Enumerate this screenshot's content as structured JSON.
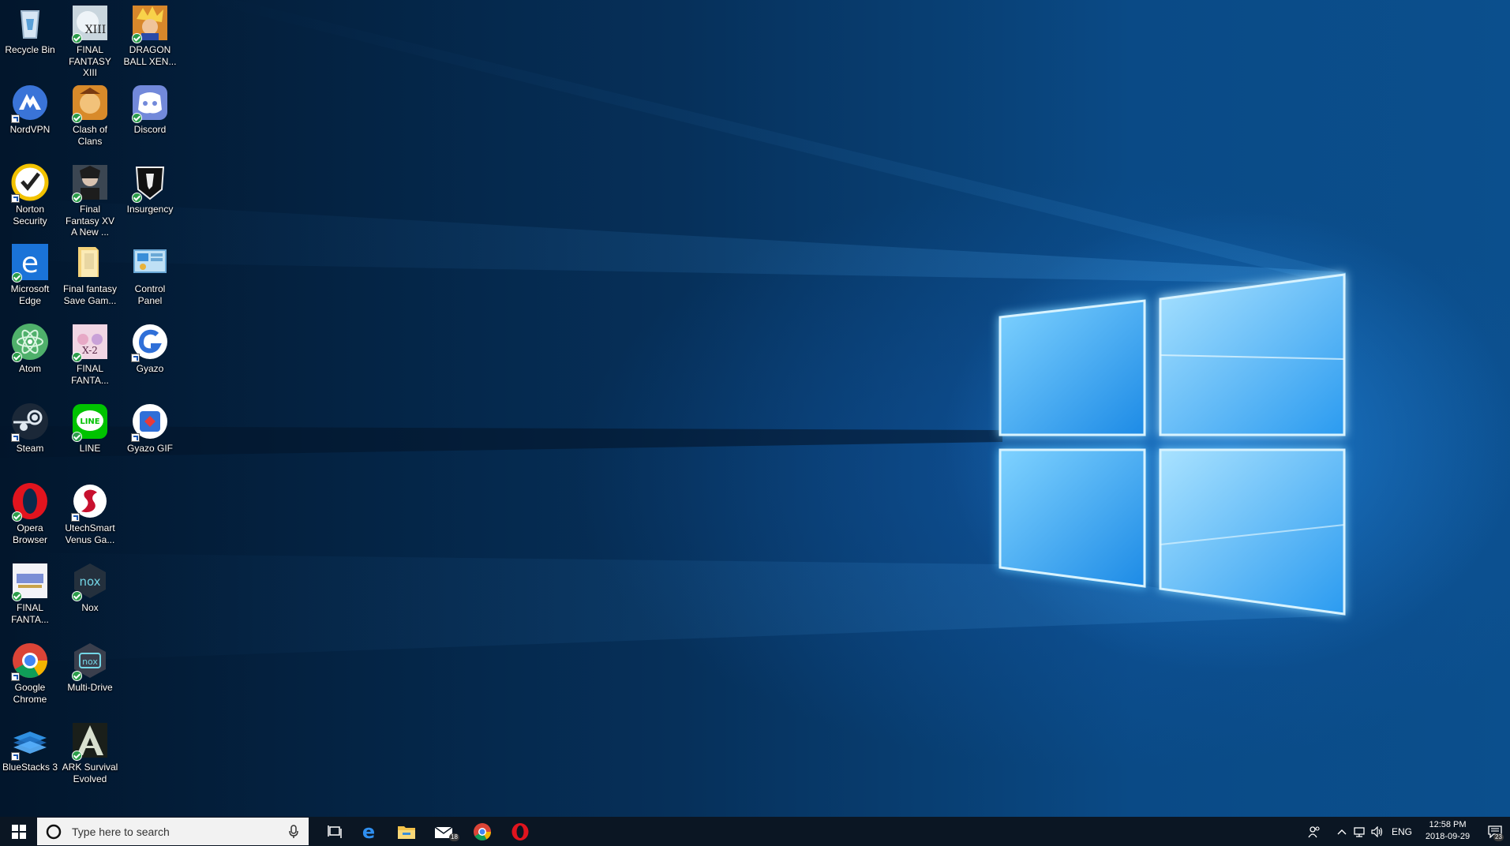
{
  "desktop": {
    "icons": [
      {
        "label": "Recycle Bin",
        "icon": "recycle-bin-icon"
      },
      {
        "label": "FINAL FANTASY XIII",
        "icon": "final-fantasy-xiii-icon"
      },
      {
        "label": "DRAGON BALL XEN...",
        "icon": "dragon-ball-icon"
      },
      {
        "label": "NordVPN",
        "icon": "nordvpn-icon"
      },
      {
        "label": "Clash of Clans",
        "icon": "clash-of-clans-icon"
      },
      {
        "label": "Discord",
        "icon": "discord-icon"
      },
      {
        "label": "Norton Security",
        "icon": "norton-icon"
      },
      {
        "label": "Final Fantasy XV  A New ...",
        "icon": "final-fantasy-xv-icon"
      },
      {
        "label": "Insurgency",
        "icon": "insurgency-icon"
      },
      {
        "label": "Microsoft Edge",
        "icon": "edge-icon"
      },
      {
        "label": "Final fantasy Save Gam...",
        "icon": "folder-icon"
      },
      {
        "label": "Control Panel",
        "icon": "control-panel-icon"
      },
      {
        "label": "Atom",
        "icon": "atom-icon"
      },
      {
        "label": "FINAL FANTA...",
        "icon": "final-fantasy-x2-icon"
      },
      {
        "label": "Gyazo",
        "icon": "gyazo-icon"
      },
      {
        "label": "Steam",
        "icon": "steam-icon"
      },
      {
        "label": "LINE",
        "icon": "line-icon"
      },
      {
        "label": "Gyazo GIF",
        "icon": "gyazo-gif-icon"
      },
      {
        "label": "Opera Browser",
        "icon": "opera-icon"
      },
      {
        "label": "UtechSmart Venus Ga...",
        "icon": "utechsmart-icon"
      },
      {
        "label": "FINAL FANTA...",
        "icon": "final-fantasy-icon"
      },
      {
        "label": "Nox",
        "icon": "nox-icon"
      },
      {
        "label": "Google Chrome",
        "icon": "chrome-icon"
      },
      {
        "label": "Multi-Drive",
        "icon": "multi-drive-icon"
      },
      {
        "label": "BlueStacks 3",
        "icon": "bluestacks-icon"
      },
      {
        "label": "ARK Survival Evolved",
        "icon": "ark-icon"
      }
    ]
  },
  "taskbar": {
    "search_placeholder": "Type here to search",
    "mail_badge": "18",
    "language": "ENG",
    "time": "12:58 PM",
    "date": "2018-09-29",
    "notification_count": "23"
  },
  "colors": {
    "taskbar": "#0b1623",
    "wallpaper_dark": "#02162c",
    "wallpaper_light": "#0b4f8d",
    "window_glow": "#5cc4ff"
  }
}
